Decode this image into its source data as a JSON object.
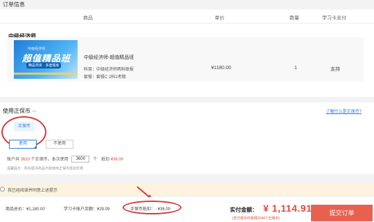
{
  "section_title": "订单信息",
  "table_header": {
    "product": "商品",
    "unit_price": "单价",
    "quantity": "数量",
    "card_pay": "学习卡支付"
  },
  "shop_name": "中级经济师",
  "product": {
    "thumb_small": "中级经济师",
    "thumb_big": "超值精品班",
    "thumb_tag": "精品师资 · 多套题库",
    "title": "中级经济师-超值精品班",
    "subject": "科目：中级经济师两科联报",
    "package": "套餐：套餐C 2科1考期",
    "price": "¥1180.00",
    "qty": "1",
    "card_support": "支持"
  },
  "coupon": {
    "title": "使用正保币",
    "help_link": "了解什么是正保币?",
    "coin_chip": "正保币",
    "use_btn": "使用",
    "no_use_btn": "不使用",
    "line_prefix": "账户共",
    "total_coins": "3620",
    "line_mid": "个正保币，本次使用",
    "use_qty": "3600",
    "line_suffix": "个　抵扣",
    "deduct": "¥36.00",
    "tip": "温馨提示：购买图书商品不能使用正保币抵扣优惠"
  },
  "agree": {
    "text": "我已经阅读并同意上述提示"
  },
  "footer": {
    "total": "商品总价：¥1,180.00",
    "card_balance": "学习卡账户余额：¥29.09",
    "coin_deduct": "正保币抵扣：- ¥36.00",
    "pay_label": "实付金额：",
    "pay_amount": "¥ 1,114.91",
    "pay_note": "(支付成功可获得1144个正保币)",
    "submit": "提交订单"
  },
  "colors": {
    "accent_red": "#e24a3a",
    "link_blue": "#2a7bd7",
    "submit_bg": "#e8614f",
    "annotation_red": "#d63a3a"
  }
}
